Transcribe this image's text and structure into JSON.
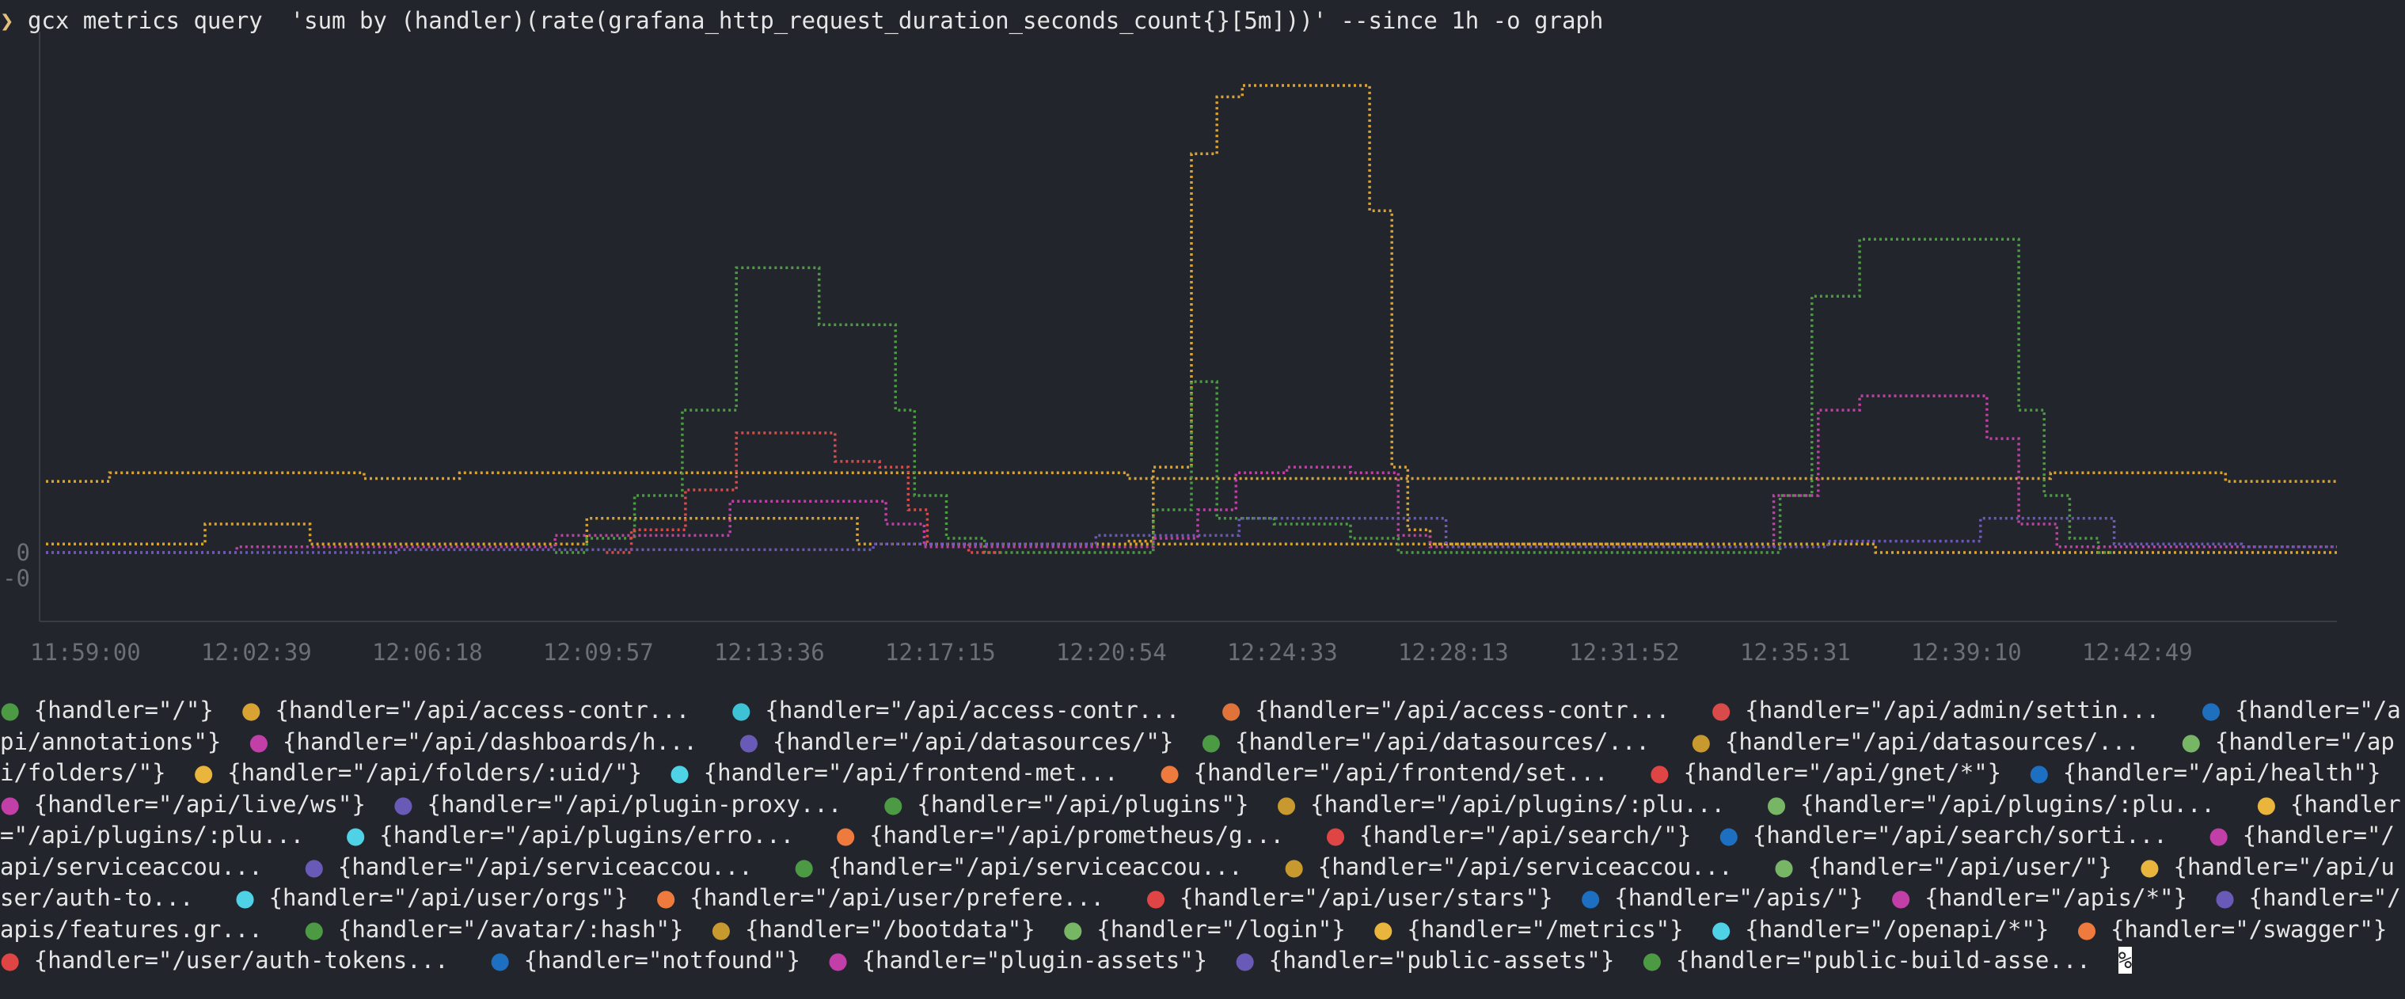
{
  "terminal": {
    "prompt_symbol": "❯",
    "command": "gcx metrics query  'sum by (handler)(rate(grafana_http_request_duration_seconds_count{}[5m]))' --since 1h -o graph",
    "end_marker": "%"
  },
  "chart_data": {
    "type": "line",
    "x_ticks": [
      "11:59:00",
      "12:02:39",
      "12:06:18",
      "12:09:57",
      "12:13:36",
      "12:17:15",
      "12:20:54",
      "12:24:33",
      "12:28:13",
      "12:31:52",
      "12:35:31",
      "12:39:10",
      "12:42:49"
    ],
    "y_tick_labels": [
      "0",
      "-0"
    ],
    "series": [
      {
        "color": "#d9a334",
        "points": [
          [
            0,
            2.5
          ],
          [
            5,
            2.5
          ],
          [
            15,
            2.8
          ],
          [
            40,
            2.8
          ],
          [
            60,
            2.6
          ],
          [
            70,
            2.8
          ],
          [
            140,
            2.8
          ],
          [
            200,
            2.6
          ],
          [
            280,
            2.6
          ],
          [
            300,
            2.6
          ],
          [
            330,
            2.8
          ],
          [
            355,
            2.5
          ],
          [
            360,
            2.5
          ]
        ]
      },
      {
        "color": "#d9a334",
        "points": [
          [
            0,
            0.3
          ],
          [
            20,
            0.3
          ],
          [
            30,
            1.0
          ],
          [
            38,
            1.0
          ],
          [
            45,
            0.3
          ],
          [
            75,
            0.3
          ],
          [
            95,
            1.2
          ],
          [
            120,
            1.2
          ],
          [
            135,
            0.3
          ],
          [
            280,
            0.3
          ],
          [
            295,
            0
          ],
          [
            360,
            0
          ]
        ]
      },
      {
        "color": "#d9a334",
        "points": [
          [
            170,
            0.4
          ],
          [
            178,
            3.0
          ],
          [
            182,
            14.0
          ],
          [
            186,
            16.0
          ],
          [
            190,
            16.4
          ],
          [
            198,
            16.4
          ],
          [
            206,
            16.4
          ],
          [
            210,
            12.0
          ],
          [
            213,
            3.0
          ],
          [
            215,
            0.8
          ],
          [
            220,
            0.3
          ],
          [
            260,
            0.3
          ]
        ]
      },
      {
        "color": "#4d9a45",
        "points": [
          [
            80,
            0
          ],
          [
            90,
            0.5
          ],
          [
            95,
            2.0
          ],
          [
            105,
            5.0
          ],
          [
            112,
            10.0
          ],
          [
            118,
            10.0
          ],
          [
            125,
            8.0
          ],
          [
            132,
            8.0
          ],
          [
            135,
            5.0
          ],
          [
            138,
            2.0
          ],
          [
            145,
            0.5
          ],
          [
            150,
            0
          ],
          [
            170,
            0
          ],
          [
            178,
            1.5
          ],
          [
            182,
            6.0
          ],
          [
            186,
            1.2
          ],
          [
            200,
            1.0
          ],
          [
            210,
            0.5
          ],
          [
            215,
            0
          ],
          [
            270,
            0
          ],
          [
            275,
            2.0
          ],
          [
            280,
            9.0
          ],
          [
            290,
            11.0
          ],
          [
            300,
            11.0
          ],
          [
            308,
            11.0
          ],
          [
            312,
            5.0
          ],
          [
            316,
            2.0
          ],
          [
            320,
            0.5
          ],
          [
            325,
            0
          ]
        ]
      },
      {
        "color": "#d94a4a",
        "points": [
          [
            88,
            0
          ],
          [
            96,
            0.8
          ],
          [
            105,
            2.2
          ],
          [
            112,
            4.2
          ],
          [
            120,
            4.2
          ],
          [
            128,
            3.2
          ],
          [
            134,
            3.0
          ],
          [
            137,
            1.5
          ],
          [
            140,
            0.3
          ],
          [
            150,
            0
          ]
        ]
      },
      {
        "color": "#c23fa7",
        "points": [
          [
            0,
            0
          ],
          [
            60,
            0.2
          ],
          [
            100,
            0.6
          ],
          [
            115,
            1.8
          ],
          [
            128,
            1.8
          ],
          [
            136,
            1.0
          ],
          [
            140,
            0.2
          ],
          [
            150,
            0.2
          ],
          [
            170,
            0.2
          ],
          [
            178,
            0.5
          ],
          [
            184,
            1.5
          ],
          [
            190,
            2.8
          ],
          [
            200,
            3.0
          ],
          [
            210,
            2.8
          ],
          [
            215,
            0.6
          ],
          [
            220,
            0.2
          ],
          [
            268,
            0.2
          ],
          [
            275,
            2.0
          ],
          [
            282,
            5.0
          ],
          [
            288,
            5.5
          ],
          [
            302,
            5.5
          ],
          [
            308,
            4.0
          ],
          [
            312,
            1.0
          ],
          [
            320,
            0.2
          ],
          [
            360,
            0.2
          ]
        ]
      },
      {
        "color": "#6a5ab8",
        "points": [
          [
            0,
            0
          ],
          [
            110,
            0.1
          ],
          [
            150,
            0.3
          ],
          [
            180,
            0.6
          ],
          [
            195,
            1.2
          ],
          [
            215,
            1.2
          ],
          [
            225,
            0.2
          ],
          [
            260,
            0.2
          ],
          [
            300,
            0.4
          ],
          [
            308,
            1.2
          ],
          [
            320,
            1.2
          ],
          [
            330,
            0.3
          ],
          [
            360,
            0.2
          ]
        ]
      }
    ],
    "y_range": [
      -0.9,
      16.4
    ],
    "x_range": [
      0,
      360
    ]
  },
  "legend": {
    "items": [
      {
        "color": "#4d9a45",
        "text": "{handler=\"/\"}"
      },
      {
        "color": "#d9a334",
        "text": "{handler=\"/api/access-contr... "
      },
      {
        "color": "#3ec3d6",
        "text": "{handler=\"/api/access-contr... "
      },
      {
        "color": "#e0733a",
        "text": "{handler=\"/api/access-contr... "
      },
      {
        "color": "#d94a4a",
        "text": "{handler=\"/api/admin/settin... "
      },
      {
        "color": "#1f6fbf",
        "text": "{handler=\"/api/annotations\"}"
      },
      {
        "color": "#c23fa7",
        "text": "{handler=\"/api/dashboards/h... "
      },
      {
        "color": "#6a5ab8",
        "text": "{handler=\"/api/datasources/\"}"
      },
      {
        "color": "#4d9a45",
        "text": "{handler=\"/api/datasources/... "
      },
      {
        "color": "#c7992e",
        "text": "{handler=\"/api/datasources/... "
      },
      {
        "color": "#77b664",
        "text": "{handler=\"/api/folders/\"}"
      },
      {
        "color": "#e9b53c",
        "text": "{handler=\"/api/folders/:uid/\"}"
      },
      {
        "color": "#4fd2e6",
        "text": "{handler=\"/api/frontend-met... "
      },
      {
        "color": "#ef7a3d",
        "text": "{handler=\"/api/frontend/set... "
      },
      {
        "color": "#e04545",
        "text": "{handler=\"/api/gnet/*\"}"
      },
      {
        "color": "#1c6fc1",
        "text": "{handler=\"/api/health\"}"
      },
      {
        "color": "#c23fa7",
        "text": "{handler=\"/api/live/ws\"}"
      },
      {
        "color": "#6a5ab8",
        "text": "{handler=\"/api/plugin-proxy... "
      },
      {
        "color": "#4d9a45",
        "text": "{handler=\"/api/plugins\"}"
      },
      {
        "color": "#c7992e",
        "text": "{handler=\"/api/plugins/:plu... "
      },
      {
        "color": "#77b664",
        "text": "{handler=\"/api/plugins/:plu... "
      },
      {
        "color": "#e9b53c",
        "text": "{handler=\"/api/plugins/:plu... "
      },
      {
        "color": "#4fd2e6",
        "text": "{handler=\"/api/plugins/erro... "
      },
      {
        "color": "#ef7a3d",
        "text": "{handler=\"/api/prometheus/g... "
      },
      {
        "color": "#e04545",
        "text": "{handler=\"/api/search/\"}"
      },
      {
        "color": "#1c6fc1",
        "text": "{handler=\"/api/search/sorti... "
      },
      {
        "color": "#c23fa7",
        "text": "{handler=\"/api/serviceaccou... "
      },
      {
        "color": "#6a5ab8",
        "text": "{handler=\"/api/serviceaccou... "
      },
      {
        "color": "#4d9a45",
        "text": "{handler=\"/api/serviceaccou... "
      },
      {
        "color": "#c7992e",
        "text": "{handler=\"/api/serviceaccou... "
      },
      {
        "color": "#77b664",
        "text": "{handler=\"/api/user/\"}"
      },
      {
        "color": "#e9b53c",
        "text": "{handler=\"/api/user/auth-to... "
      },
      {
        "color": "#4fd2e6",
        "text": "{handler=\"/api/user/orgs\"}"
      },
      {
        "color": "#ef7a3d",
        "text": "{handler=\"/api/user/prefere... "
      },
      {
        "color": "#e04545",
        "text": "{handler=\"/api/user/stars\"}"
      },
      {
        "color": "#1c6fc1",
        "text": "{handler=\"/apis/\"}"
      },
      {
        "color": "#c23fa7",
        "text": "{handler=\"/apis/*\"}"
      },
      {
        "color": "#6a5ab8",
        "text": "{handler=\"/apis/features.gr... "
      },
      {
        "color": "#4d9a45",
        "text": "{handler=\"/avatar/:hash\"}"
      },
      {
        "color": "#c7992e",
        "text": "{handler=\"/bootdata\"}"
      },
      {
        "color": "#77b664",
        "text": "{handler=\"/login\"}"
      },
      {
        "color": "#e9b53c",
        "text": "{handler=\"/metrics\"}"
      },
      {
        "color": "#4fd2e6",
        "text": "{handler=\"/openapi/*\"}"
      },
      {
        "color": "#ef7a3d",
        "text": "{handler=\"/swagger\"}"
      },
      {
        "color": "#e04545",
        "text": "{handler=\"/user/auth-tokens... "
      },
      {
        "color": "#1c6fc1",
        "text": "{handler=\"notfound\"}"
      },
      {
        "color": "#c23fa7",
        "text": "{handler=\"plugin-assets\"}"
      },
      {
        "color": "#6a5ab8",
        "text": "{handler=\"public-assets\"}"
      },
      {
        "color": "#4d9a45",
        "text": "{handler=\"public-build-asse..."
      }
    ]
  }
}
